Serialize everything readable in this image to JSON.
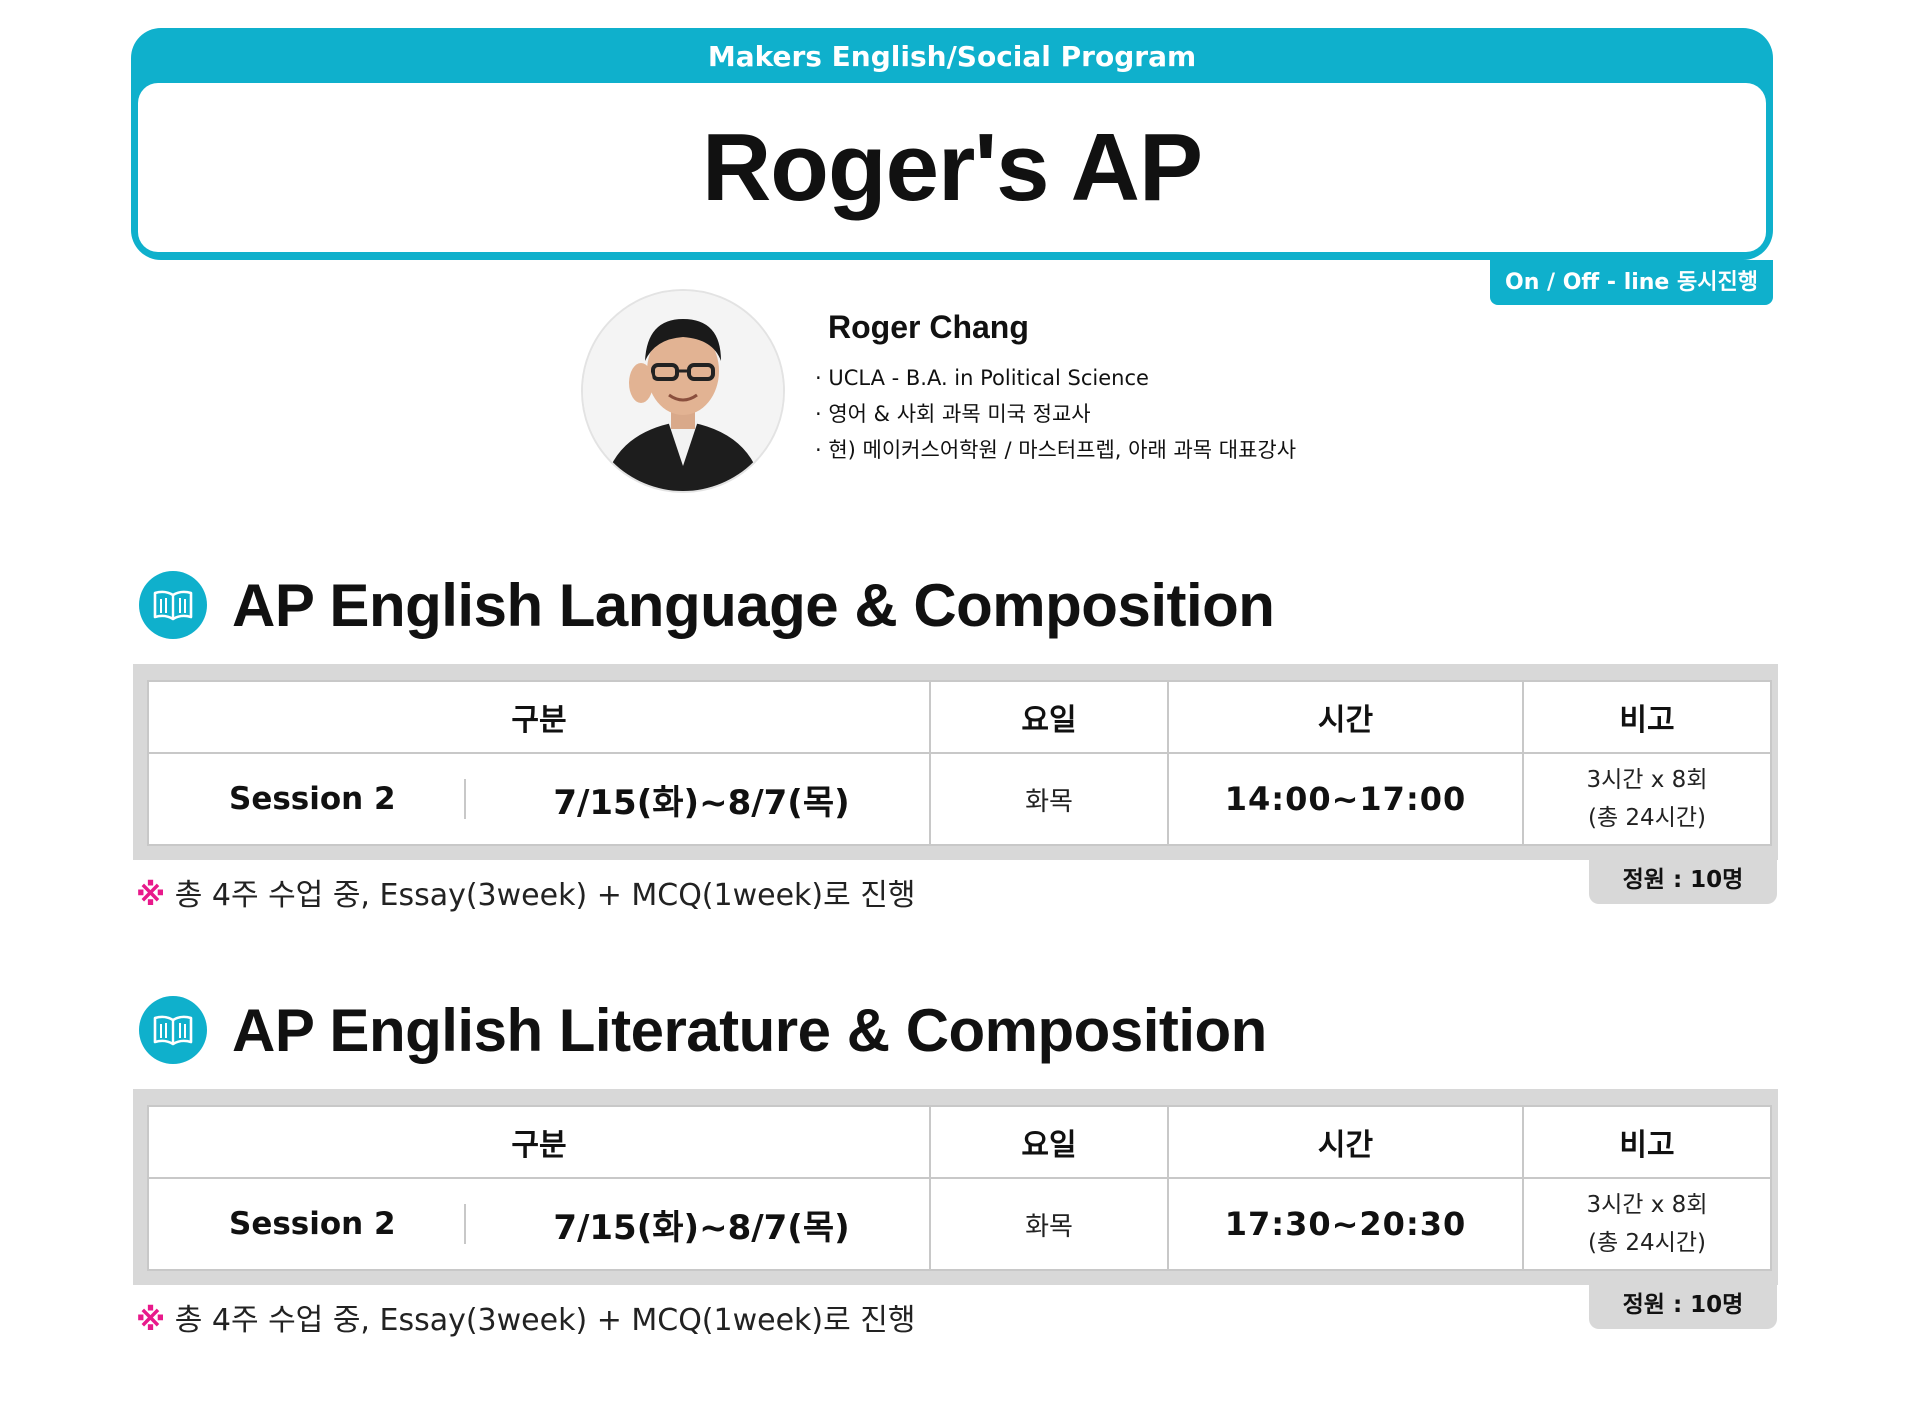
{
  "header": {
    "program": "Makers English/Social Program",
    "title": "Roger's AP",
    "mode_tag": "On / Off - line 동시진행"
  },
  "instructor": {
    "name": "Roger Chang",
    "credentials": [
      "UCLA - B.A. in Political Science",
      "영어 & 사회 과목 미국 정교사",
      "현) 메이커스어학원 / 마스터프렙, 아래 과목 대표강사"
    ]
  },
  "table_headers": {
    "category": "구분",
    "day": "요일",
    "time": "시간",
    "note": "비고"
  },
  "courses": [
    {
      "title": "AP English Language & Composition",
      "session": "Session 2",
      "dates": "7/15(화)~8/7(목)",
      "days": "화목",
      "time": "14:00~17:00",
      "note_line1": "3시간 x 8회",
      "note_line2": "(총 24시간)",
      "capacity": "정원 : 10명",
      "footnote_mark": "※",
      "footnote": "총 4주 수업 중, Essay(3week) + MCQ(1week)로 진행"
    },
    {
      "title": "AP English Literature & Composition",
      "session": "Session 2",
      "dates": "7/15(화)~8/7(목)",
      "days": "화목",
      "time": "17:30~20:30",
      "note_line1": "3시간 x 8회",
      "note_line2": "(총 24시간)",
      "capacity": "정원 : 10명",
      "footnote_mark": "※",
      "footnote": "총 4주 수업 중, Essay(3week) + MCQ(1week)로 진행"
    }
  ],
  "colors": {
    "accent": "#0fb0cc",
    "highlight": "#e8198b",
    "table_frame": "#d8d8d8"
  },
  "icons": {
    "avatar": "instructor-photo",
    "course": "open-book-icon"
  }
}
